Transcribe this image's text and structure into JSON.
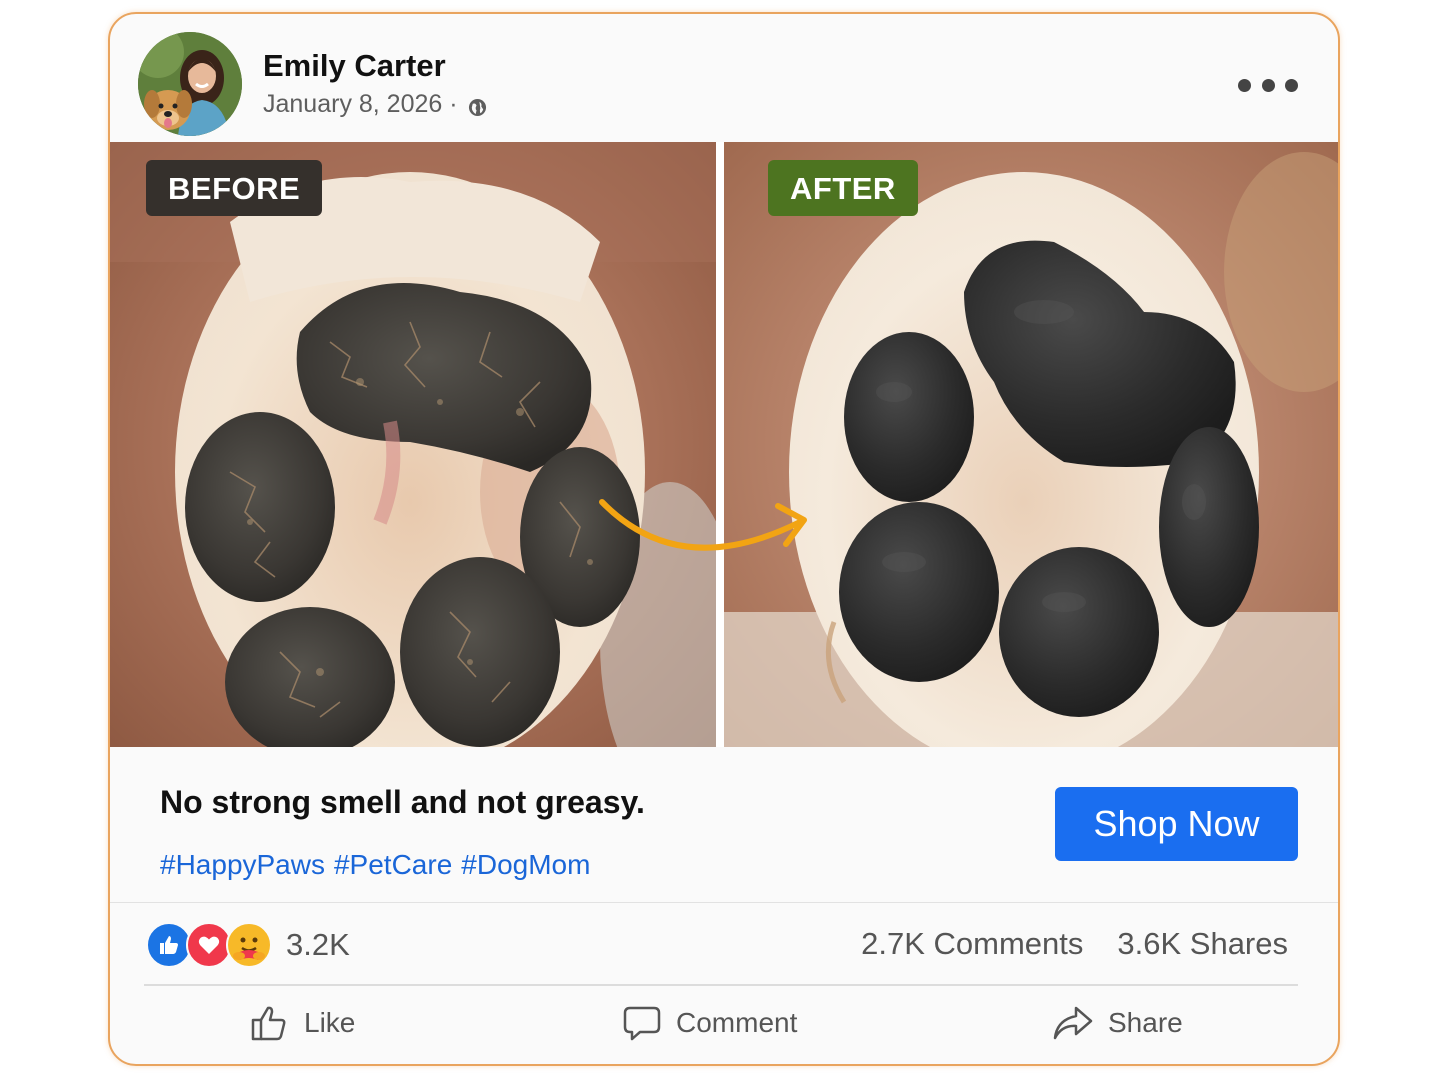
{
  "post": {
    "author_name": "Emily Carter",
    "date": "January 8, 2026 ·",
    "privacy_icon": "globe-icon",
    "more_icon": "more-options-icon"
  },
  "photos": {
    "before_label": "BEFORE",
    "after_label": "AFTER",
    "before_tag_color": "#35302c",
    "after_tag_color": "#4d7420",
    "arrow_color": "#f2a413"
  },
  "content": {
    "caption": "No strong smell and not greasy.",
    "hashtags": [
      "#HappyPaws",
      "#PetCare",
      "#DogMom"
    ],
    "cta_label": "Shop Now",
    "cta_color": "#1a6ef0"
  },
  "stats": {
    "reaction_icons": [
      "like-reaction-icon",
      "love-reaction-icon",
      "care-reaction-icon"
    ],
    "reaction_count": "3.2K",
    "comments": "2.7K Comments",
    "shares": "3.6K Shares"
  },
  "actions": {
    "like_label": "Like",
    "comment_label": "Comment",
    "share_label": "Share"
  }
}
